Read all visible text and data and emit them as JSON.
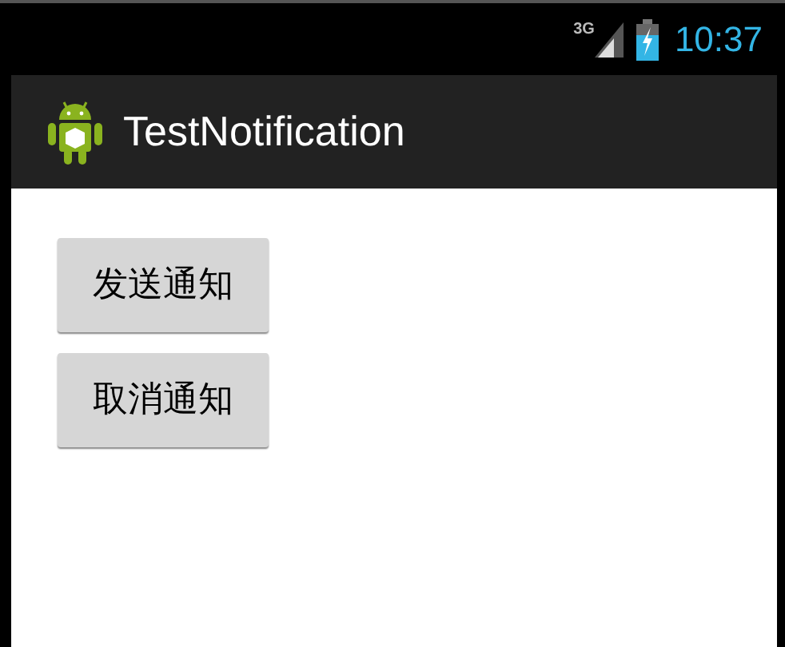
{
  "status_bar": {
    "network": "3G",
    "time": "10:37"
  },
  "action_bar": {
    "title": "TestNotification"
  },
  "buttons": [
    "发送通知",
    "取消通知"
  ]
}
